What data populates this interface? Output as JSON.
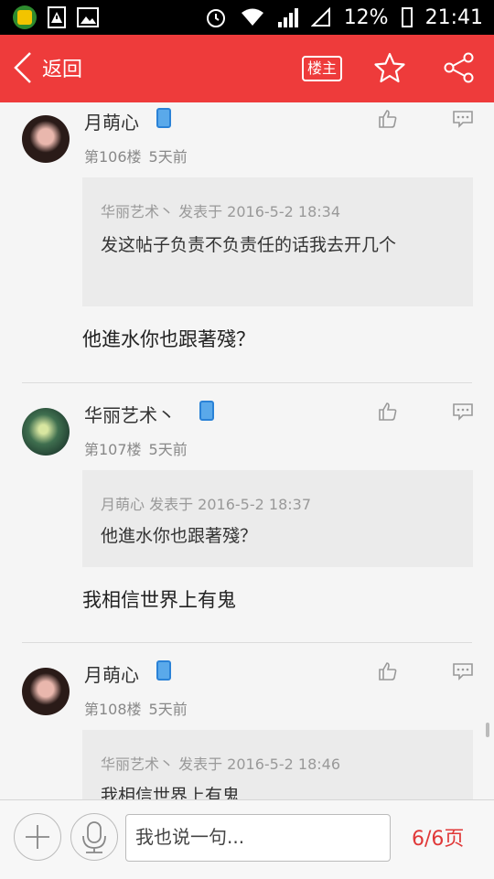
{
  "status_bar": {
    "battery": "12%",
    "time": "21:41"
  },
  "header": {
    "back_label": "返回",
    "owner_label": "楼主"
  },
  "posts": [
    {
      "name": "月萌心",
      "floor": "第106楼",
      "time": "5天前",
      "quote_meta": "华丽艺术丶  发表于 2016-5-2 18:34",
      "quote_text": "发这帖子负责不负责任的话我去开几个",
      "body": "他進水你也跟著殘？"
    },
    {
      "name": "华丽艺术丶",
      "floor": "第107楼",
      "time": "5天前",
      "quote_meta": "月萌心 发表于 2016-5-2 18:37",
      "quote_text": "他進水你也跟著殘？",
      "body": "我相信世界上有鬼"
    },
    {
      "name": "月萌心",
      "floor": "第108楼",
      "time": "5天前",
      "quote_meta": "华丽艺术丶  发表于 2016-5-2 18:46",
      "quote_text": "我相信世界上有鬼"
    }
  ],
  "bottom_bar": {
    "input_placeholder": "我也说一句...",
    "page_indicator": "6/6页"
  },
  "colors": {
    "accent": "#ee3b3b",
    "page_indicator": "#e03838"
  }
}
